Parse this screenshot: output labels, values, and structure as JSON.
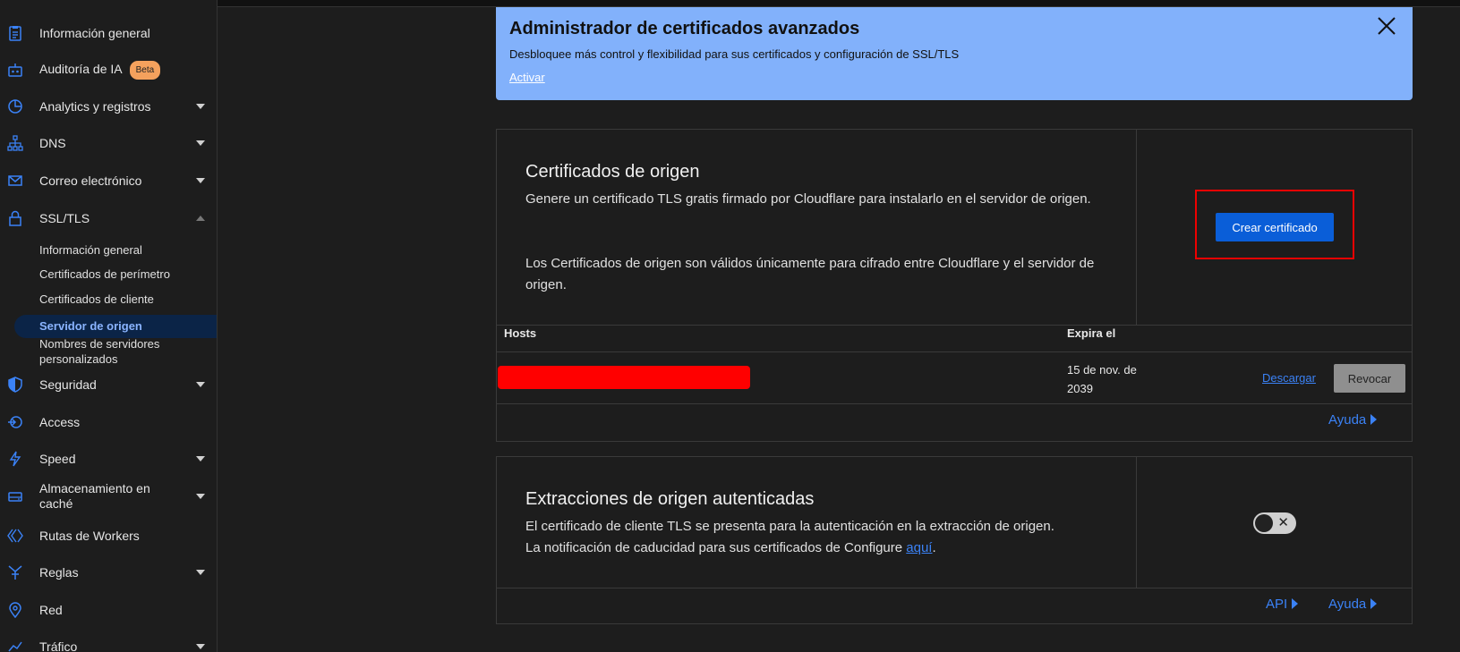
{
  "sidebar": {
    "items": [
      {
        "label": "Información general",
        "icon": "clipboard-icon"
      },
      {
        "label": "Auditoría de IA",
        "icon": "robot-icon",
        "badge": "Beta"
      },
      {
        "label": "Analytics y registros",
        "icon": "pie-chart-icon"
      },
      {
        "label": "DNS",
        "icon": "network-icon"
      },
      {
        "label": "Correo electrónico",
        "icon": "envelope-icon"
      },
      {
        "label": "SSL/TLS",
        "icon": "lock-icon"
      },
      {
        "label": "Seguridad",
        "icon": "shield-icon"
      },
      {
        "label": "Access",
        "icon": "access-icon"
      },
      {
        "label": "Speed",
        "icon": "lightning-icon"
      },
      {
        "label": "Almacenamiento en caché",
        "icon": "drive-icon"
      },
      {
        "label": "Rutas de Workers",
        "icon": "workers-icon"
      },
      {
        "label": "Reglas",
        "icon": "rules-icon"
      },
      {
        "label": "Red",
        "icon": "location-pin-icon"
      },
      {
        "label": "Tráfico",
        "icon": "traffic-icon"
      }
    ],
    "ssl_subitems": [
      {
        "label": "Información general"
      },
      {
        "label": "Certificados de perímetro"
      },
      {
        "label": "Certificados de cliente"
      },
      {
        "label": "Servidor de origen",
        "active": true
      },
      {
        "label": "Nombres de servidores personalizados"
      }
    ]
  },
  "banner": {
    "title": "Administrador de certificados avanzados",
    "description": "Desbloquee más control y flexibilidad para sus certificados y configuración de SSL/TLS",
    "link": "Activar"
  },
  "origin_certs": {
    "title": "Certificados de origen",
    "paragraph1": "Genere un certificado TLS gratis firmado por Cloudflare para instalarlo en el servidor de origen.",
    "paragraph2": "Los Certificados de origen son válidos únicamente para cifrado entre Cloudflare y el servidor de origen.",
    "create_button": "Crear certificado",
    "table": {
      "headers": [
        "Hosts",
        "Expira el"
      ],
      "rows": [
        {
          "host": "",
          "expires": "15 de nov. de 2039"
        }
      ]
    },
    "download_link": "Descargar",
    "revoke_button": "Revocar",
    "help_link": "Ayuda"
  },
  "authenticated_pulls": {
    "title": "Extracciones de origen autenticadas",
    "line1": "El certificado de cliente TLS se presenta para la autenticación en la extracción de origen.",
    "line2_prefix": "La notificación de caducidad para sus certificados de Configure ",
    "line2_link": "aquí",
    "line2_suffix": ".",
    "toggle_state": "off",
    "api_link": "API",
    "help_link": "Ayuda"
  },
  "colors": {
    "accent": "#0a5ed8",
    "link": "#3b82f6",
    "banner_bg": "#82b1fb",
    "badge": "#f4a15d",
    "highlight": "#e00000"
  }
}
